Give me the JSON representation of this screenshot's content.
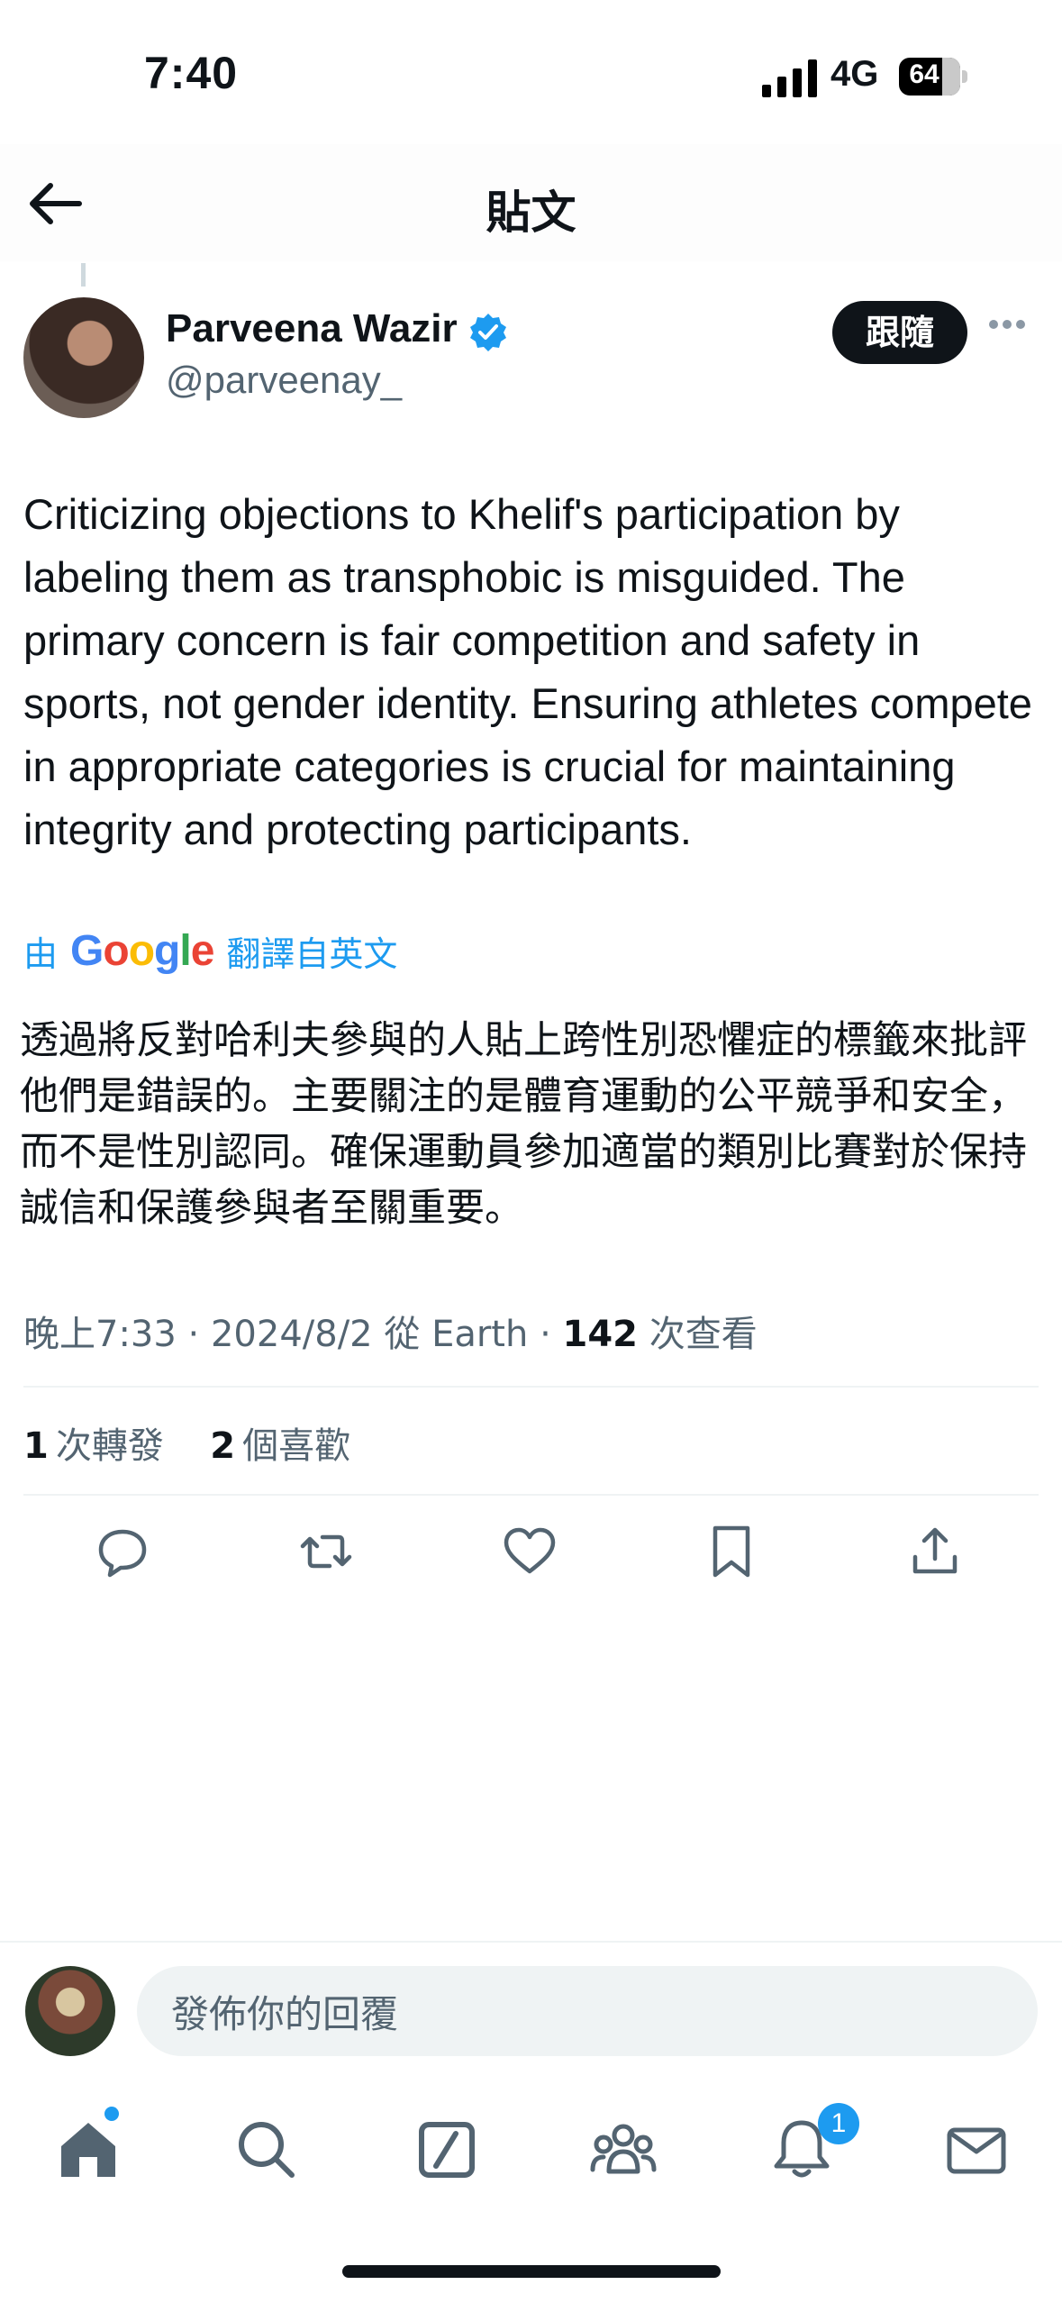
{
  "status_bar": {
    "time": "7:40",
    "network": "4G",
    "battery": "64"
  },
  "header": {
    "title": "貼文",
    "back_icon": "arrow-left-icon"
  },
  "author": {
    "name": "Parveena Wazir",
    "handle": "@parveenay_",
    "follow_label": "跟隨",
    "verified": true
  },
  "tweet": {
    "text": "Criticizing objections to Khelif's participation by labeling them as transphobic is misguided. The primary concern is fair competition and safety in sports, not gender identity. Ensuring athletes compete in appropriate categories is crucial for maintaining integrity and protecting participants.",
    "translate_prefix": "由",
    "translate_brand": "Google",
    "translate_suffix": "翻譯自英文",
    "translated_text": "透過將反對哈利夫參與的人貼上跨性別恐懼症的標籤來批評他們是錯誤的。主要關注的是體育運動的公平競爭和安全，而不是性別認同。確保運動員參加適當的類別比賽對於保持誠信和保護參與者至關重要。"
  },
  "meta": {
    "time": "晚上7:33",
    "date": "2024/8/2",
    "source": "從 Earth",
    "views_count": "142",
    "views_label": "次查看"
  },
  "stats": {
    "reposts_count": "1",
    "reposts_label": "次轉發",
    "likes_count": "2",
    "likes_label": "個喜歡"
  },
  "reply": {
    "placeholder": "發佈你的回覆"
  },
  "tabs": {
    "notifications_badge": "1"
  },
  "colors": {
    "accent": "#1d9bf0",
    "text": "#0f1419",
    "secondary": "#536471"
  }
}
